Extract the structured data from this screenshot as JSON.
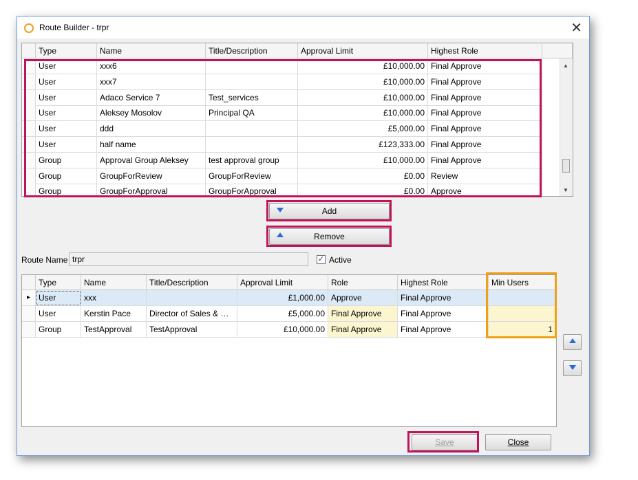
{
  "window": {
    "title": "Route Builder - trpr",
    "close_glyph": "✕"
  },
  "top_grid": {
    "columns": [
      "Type",
      "Name",
      "Title/Description",
      "Approval Limit",
      "Highest Role"
    ],
    "rows": [
      {
        "type": "User",
        "name": "xxx6",
        "title": "",
        "limit": "£10,000.00",
        "role": "Final Approve"
      },
      {
        "type": "User",
        "name": "xxx7",
        "title": "",
        "limit": "£10,000.00",
        "role": "Final Approve"
      },
      {
        "type": "User",
        "name": "Adaco Service 7",
        "title": "Test_services",
        "limit": "£10,000.00",
        "role": "Final Approve"
      },
      {
        "type": "User",
        "name": "Aleksey Mosolov",
        "title": "Principal QA",
        "limit": "£10,000.00",
        "role": "Final Approve"
      },
      {
        "type": "User",
        "name": "ddd",
        "title": "",
        "limit": "£5,000.00",
        "role": "Final Approve"
      },
      {
        "type": "User",
        "name": "half name",
        "title": "",
        "limit": "£123,333.00",
        "role": "Final Approve"
      },
      {
        "type": "Group",
        "name": "Approval Group Aleksey",
        "title": "test approval group",
        "limit": "£10,000.00",
        "role": "Final Approve"
      },
      {
        "type": "Group",
        "name": "GroupForReview",
        "title": "GroupForReview",
        "limit": "£0.00",
        "role": "Review"
      },
      {
        "type": "Group",
        "name": "GroupForApproval",
        "title": "GroupForApproval",
        "limit": "£0.00",
        "role": "Approve"
      }
    ]
  },
  "buttons": {
    "add": "Add",
    "remove": "Remove",
    "save": "Save",
    "close": "Close"
  },
  "route": {
    "name_label": "Route Name",
    "name_value": "trpr",
    "active_label": "Active",
    "active_checked": true
  },
  "bottom_grid": {
    "columns": [
      "Type",
      "Name",
      "Title/Description",
      "Approval Limit",
      "Role",
      "Highest Role",
      "Min Users"
    ],
    "rows": [
      {
        "type": "User",
        "name": "xxx",
        "title": "",
        "limit": "£1,000.00",
        "role": "Approve",
        "highest": "Final Approve",
        "min": ""
      },
      {
        "type": "User",
        "name": "Kerstin Pace",
        "title": "Director of Sales & M...",
        "limit": "£5,000.00",
        "role": "Final Approve",
        "highest": "Final Approve",
        "min": ""
      },
      {
        "type": "Group",
        "name": "TestApproval",
        "title": "TestApproval",
        "limit": "£10,000.00",
        "role": "Final Approve",
        "highest": "Final Approve",
        "min": "1"
      }
    ]
  },
  "colors": {
    "highlight_red": "#c0145a",
    "highlight_orange": "#f0a018",
    "icon_blue": "#2b6bd6"
  }
}
